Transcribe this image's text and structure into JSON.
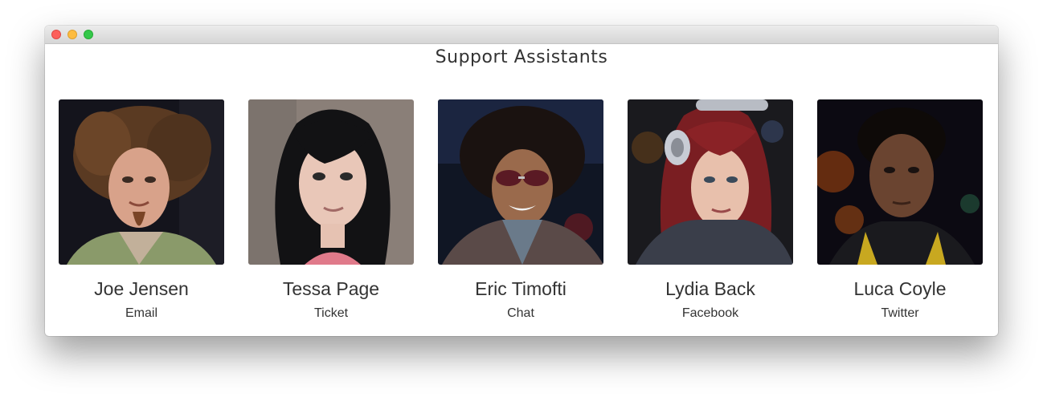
{
  "window": {
    "title": "Support Assistants"
  },
  "assistants": [
    {
      "name": "Joe Jensen",
      "channel": "Email"
    },
    {
      "name": "Tessa Page",
      "channel": "Ticket"
    },
    {
      "name": "Eric Timofti",
      "channel": "Chat"
    },
    {
      "name": "Lydia Back",
      "channel": "Facebook"
    },
    {
      "name": "Luca Coyle",
      "channel": "Twitter"
    }
  ],
  "colors": {
    "close": "#fc605c",
    "minimize": "#fdbc40",
    "zoom": "#34c84a",
    "text": "#333333"
  }
}
